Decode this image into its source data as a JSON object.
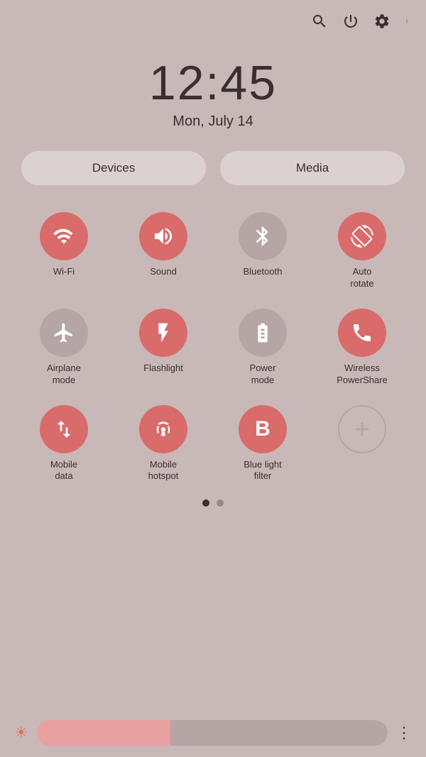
{
  "topbar": {
    "icons": [
      "search",
      "power",
      "settings",
      "more"
    ]
  },
  "clock": {
    "time": "12:45",
    "date": "Mon, July 14"
  },
  "tabs": {
    "devices_label": "Devices",
    "media_label": "Media"
  },
  "quicksettings": {
    "items": [
      {
        "id": "wifi",
        "label": "Wi-Fi",
        "state": "active"
      },
      {
        "id": "sound",
        "label": "Sound",
        "state": "active"
      },
      {
        "id": "bluetooth",
        "label": "Bluetooth",
        "state": "inactive"
      },
      {
        "id": "autorotate",
        "label": "Auto\nrotate",
        "state": "active"
      },
      {
        "id": "airplanemode",
        "label": "Airplane\nmode",
        "state": "inactive"
      },
      {
        "id": "flashlight",
        "label": "Flashlight",
        "state": "active"
      },
      {
        "id": "powermode",
        "label": "Power\nmode",
        "state": "inactive"
      },
      {
        "id": "wirelesspowershare",
        "label": "Wireless\nPowerShare",
        "state": "active"
      },
      {
        "id": "mobiledata",
        "label": "Mobile\ndata",
        "state": "active"
      },
      {
        "id": "mobilehotspot",
        "label": "Mobile\nhotspot",
        "state": "active"
      },
      {
        "id": "bluelightfilter",
        "label": "Blue light\nfilter",
        "state": "active"
      },
      {
        "id": "add",
        "label": "",
        "state": "inactive"
      }
    ]
  },
  "pagination": {
    "current": 0,
    "total": 2
  },
  "brightness": {
    "sun_icon": "☀",
    "more_icon": "⋮",
    "fill_percent": 38
  }
}
